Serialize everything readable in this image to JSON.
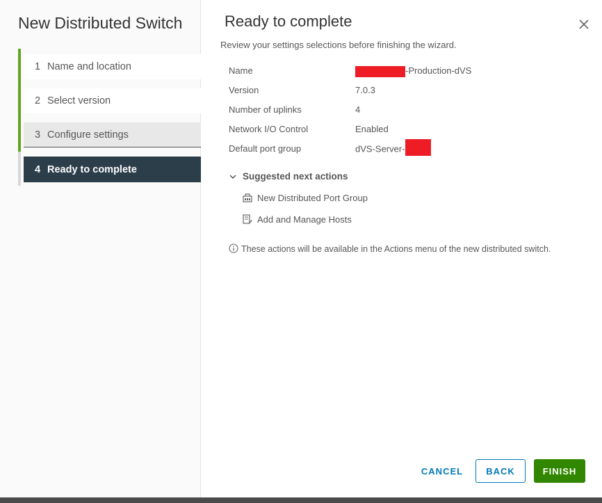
{
  "wizard": {
    "title": "New Distributed Switch",
    "steps": [
      {
        "num": "1",
        "label": "Name and location"
      },
      {
        "num": "2",
        "label": "Select version"
      },
      {
        "num": "3",
        "label": "Configure settings"
      },
      {
        "num": "4",
        "label": "Ready to complete"
      }
    ]
  },
  "page": {
    "title": "Ready to complete",
    "subtitle": "Review your settings selections before finishing the wizard."
  },
  "summary": [
    {
      "key": "Name",
      "value": "-Production-dVS"
    },
    {
      "key": "Version",
      "value": "7.0.3"
    },
    {
      "key": "Number of uplinks",
      "value": "4"
    },
    {
      "key": "Network I/O Control",
      "value": "Enabled"
    },
    {
      "key": "Default port group",
      "value": "dVS-Server-"
    }
  ],
  "suggested": {
    "heading": "Suggested next actions",
    "actions": [
      {
        "label": "New Distributed Port Group",
        "icon": "port-group-icon"
      },
      {
        "label": "Add and Manage Hosts",
        "icon": "hosts-icon"
      }
    ],
    "info": "These actions will be available in the Actions menu of the new distributed switch."
  },
  "buttons": {
    "cancel": "CANCEL",
    "back": "BACK",
    "finish": "FINISH"
  },
  "colors": {
    "active_step": "#2d3e4b",
    "progress": "#62a420",
    "primary": "#0079b8",
    "finish": "#318700",
    "redaction": "#ee1c25"
  }
}
